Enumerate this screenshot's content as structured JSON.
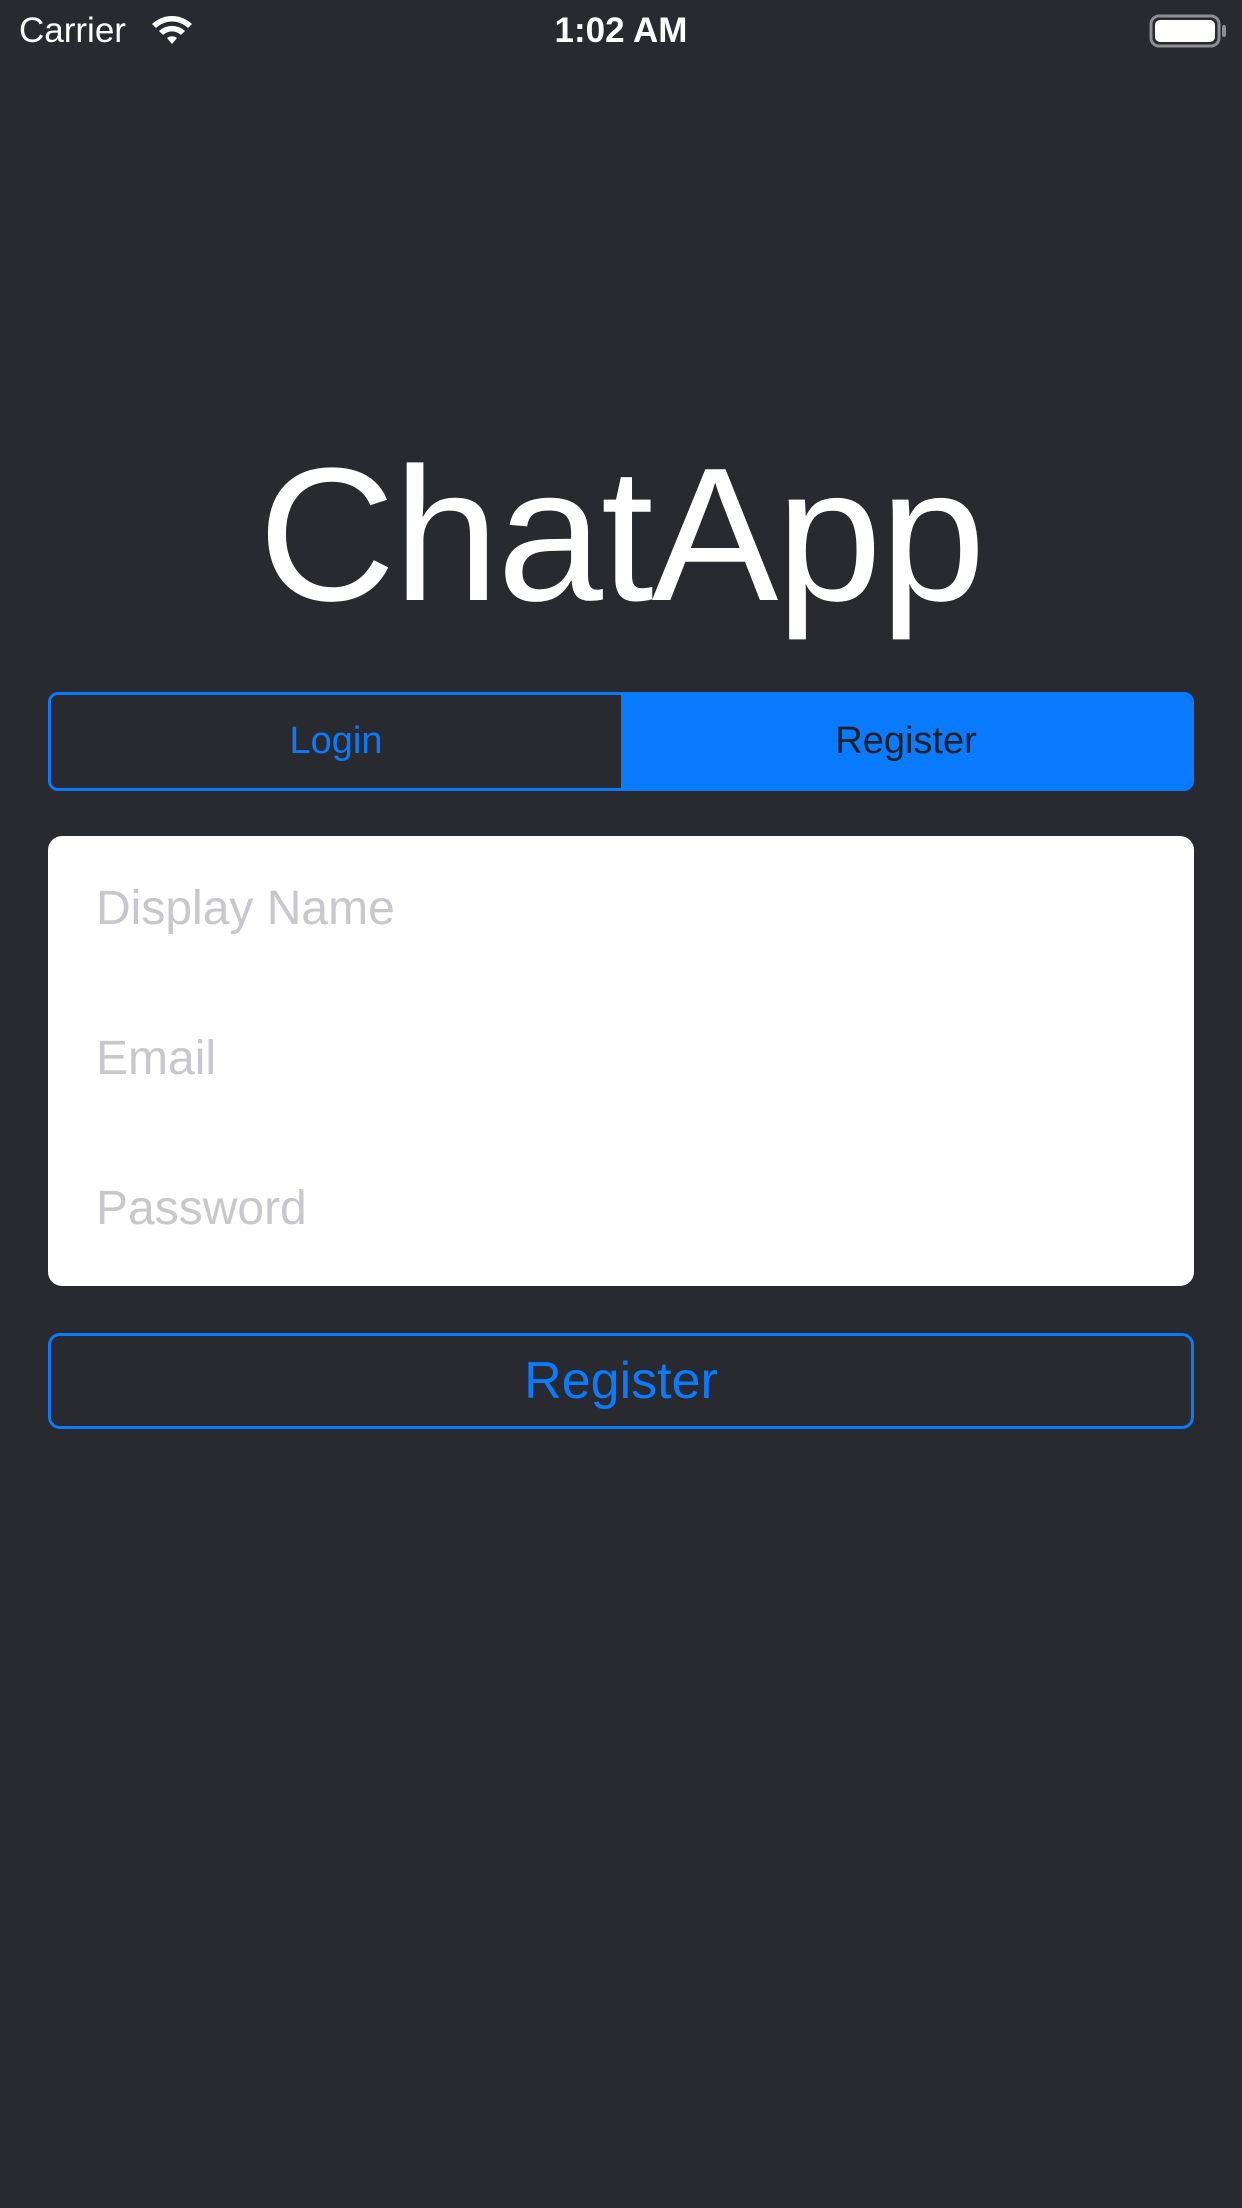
{
  "status_bar": {
    "carrier": "Carrier",
    "time": "1:02 AM",
    "wifi_icon": "wifi-icon",
    "battery_icon": "battery-icon"
  },
  "app": {
    "title": "ChatApp"
  },
  "segmented_control": {
    "segments": [
      {
        "label": "Login",
        "selected": false
      },
      {
        "label": "Register",
        "selected": true
      }
    ]
  },
  "form": {
    "fields": [
      {
        "placeholder": "Display Name",
        "value": ""
      },
      {
        "placeholder": "Email",
        "value": ""
      },
      {
        "placeholder": "Password",
        "value": ""
      }
    ]
  },
  "actions": {
    "register_label": "Register"
  },
  "colors": {
    "background": "#282A30",
    "accent": "#0A7AFF",
    "card": "#FFFFFF",
    "placeholder": "#C7C7CD"
  }
}
